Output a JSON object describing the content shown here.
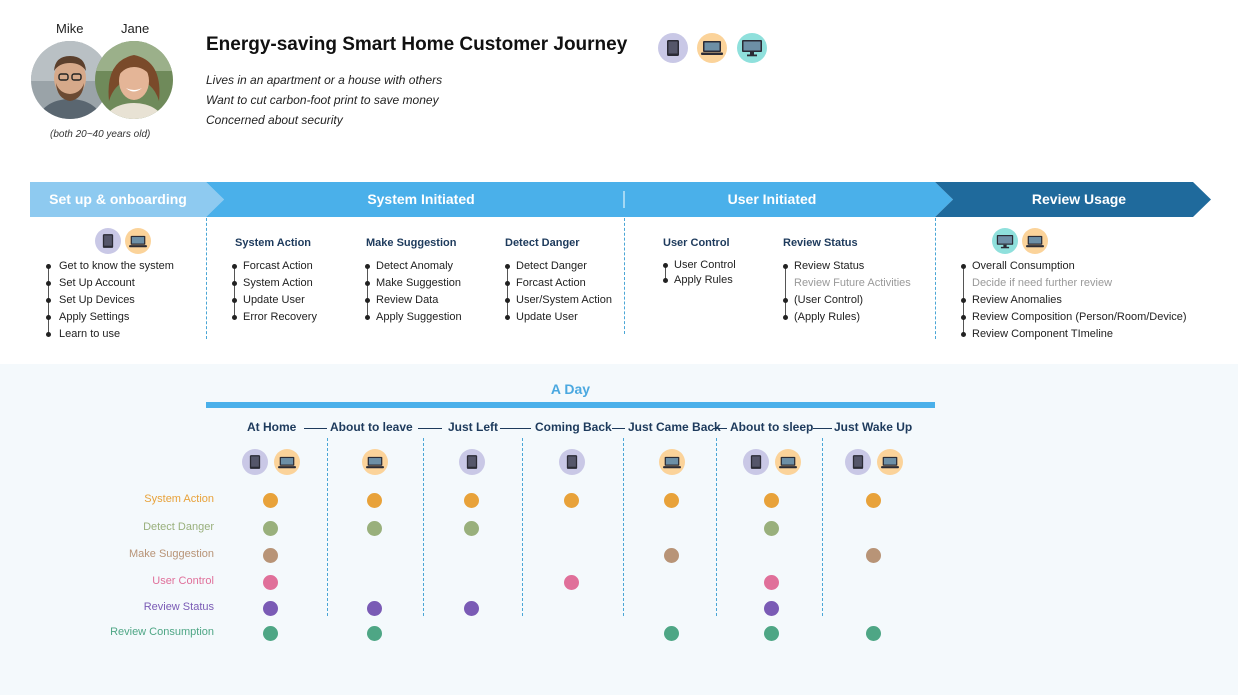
{
  "personas": [
    {
      "name": "Mike"
    },
    {
      "name": "Jane"
    }
  ],
  "persona_note": "(both 20~40 years old)",
  "title": "Energy-saving Smart Home Customer Journey",
  "descriptions": [
    "Lives in an apartment or a house with others",
    "Want to cut carbon-foot print to save money",
    "Concerned about security"
  ],
  "header_devices": [
    "tablet-icon",
    "laptop-icon",
    "monitor-icon"
  ],
  "colors": {
    "phase1": "#8ecaf0",
    "phase2": "#4ab0ea",
    "phase3": "#4ab0ea",
    "phase4": "#1f6a9c",
    "system_action": "#e8a23a",
    "detect_danger": "#99b07c",
    "make_suggestion": "#b89477",
    "user_control": "#e0709a",
    "review_status": "#7a5bb5",
    "review_consumption": "#4ea685"
  },
  "phases": [
    {
      "label": "Set up & onboarding"
    },
    {
      "label": "System Initiated"
    },
    {
      "label": "User Initiated"
    },
    {
      "label": "Review Usage"
    }
  ],
  "onboarding": {
    "devices": [
      "tablet-icon",
      "laptop-icon"
    ],
    "items": [
      "Get to know the system",
      "Set Up Account",
      "Set Up Devices",
      "Apply Settings",
      "Learn to use"
    ]
  },
  "system_initiated": [
    {
      "heading": "System Action",
      "items": [
        "Forcast Action",
        "System Action",
        "Update User",
        "Error Recovery"
      ]
    },
    {
      "heading": "Make Suggestion",
      "items": [
        "Detect Anomaly",
        "Make Suggestion",
        "Review Data",
        "Apply Suggestion"
      ]
    },
    {
      "heading": "Detect Danger",
      "items": [
        "Detect Danger",
        "Forcast Action",
        "User/System Action",
        "Update User"
      ]
    }
  ],
  "user_initiated": [
    {
      "heading": "User Control",
      "items": [
        "User Control",
        "Apply Rules"
      ]
    },
    {
      "heading": "Review Status",
      "items": [
        "Review Status",
        "Review Future Activities",
        "(User Control)",
        "(Apply Rules)"
      ]
    }
  ],
  "review_usage": {
    "devices": [
      "monitor-icon",
      "laptop-icon"
    ],
    "items": [
      "Overall Consumption",
      "Decide if need further review",
      "Review Anomalies",
      "Review Composition (Person/Room/Device)",
      "Review Component TImeline"
    ]
  },
  "day": {
    "title": "A Day",
    "moments": [
      "At Home",
      "About to leave",
      "Just Left",
      "Coming Back",
      "Just Came Back",
      "About to sleep",
      "Just Wake Up"
    ],
    "moment_devices": [
      [
        "tablet-icon",
        "laptop-icon"
      ],
      [
        "laptop-icon"
      ],
      [
        "tablet-icon"
      ],
      [
        "tablet-icon"
      ],
      [
        "laptop-icon"
      ],
      [
        "tablet-icon",
        "laptop-icon"
      ],
      [
        "tablet-icon",
        "laptop-icon"
      ]
    ],
    "rows": [
      {
        "label": "System Action",
        "color_key": "system_action",
        "present": [
          true,
          true,
          true,
          true,
          true,
          true,
          true
        ]
      },
      {
        "label": "Detect Danger",
        "color_key": "detect_danger",
        "present": [
          true,
          true,
          true,
          false,
          false,
          true,
          false
        ]
      },
      {
        "label": "Make Suggestion",
        "color_key": "make_suggestion",
        "present": [
          true,
          false,
          false,
          false,
          true,
          false,
          true
        ]
      },
      {
        "label": "User Control",
        "color_key": "user_control",
        "present": [
          true,
          false,
          false,
          true,
          false,
          true,
          false
        ]
      },
      {
        "label": "Review Status",
        "color_key": "review_status",
        "present": [
          true,
          true,
          true,
          false,
          false,
          true,
          false
        ]
      },
      {
        "label": "Review Consumption",
        "color_key": "review_consumption",
        "present": [
          true,
          true,
          false,
          false,
          true,
          true,
          true
        ]
      }
    ]
  }
}
